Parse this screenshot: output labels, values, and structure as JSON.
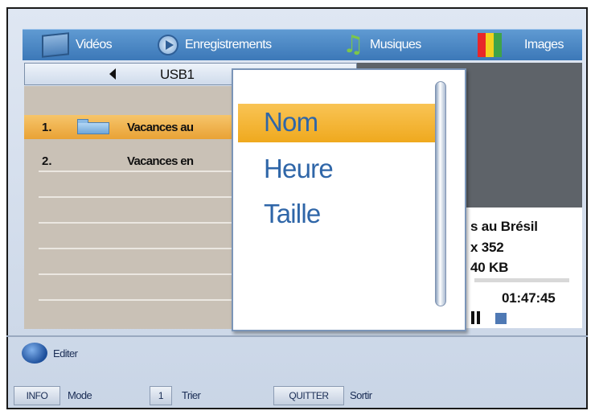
{
  "tabs": [
    {
      "label": "Vidéos",
      "icon": "video-icon"
    },
    {
      "label": "Enregistrements",
      "icon": "recordings-icon"
    },
    {
      "label": "Musiques",
      "icon": "music-icon"
    },
    {
      "label": "Images",
      "icon": "images-icon"
    }
  ],
  "breadcrumb": {
    "label": "USB1"
  },
  "files": [
    {
      "num": "1.",
      "name": "Vacances au",
      "is_folder": true,
      "selected": true
    },
    {
      "num": "2.",
      "name": "Vacances en",
      "is_folder": false,
      "selected": false
    }
  ],
  "sort_menu": {
    "options": [
      "Nom",
      "Heure",
      "Taille"
    ],
    "selected": "Nom"
  },
  "details": {
    "title": "s au Brésil",
    "resolution": "x 352",
    "size": "40 KB",
    "duration": "01:47:45"
  },
  "footer": {
    "blue_label": "Editer",
    "keys": [
      {
        "key": "INFO",
        "label": "Mode"
      },
      {
        "key": "1",
        "label": "Trier"
      },
      {
        "key": "QUITTER",
        "label": "Sortir"
      }
    ]
  },
  "colors": {
    "tabbar": "#3c78b8",
    "selection": "#f0a526",
    "popup_text": "#2f66a8",
    "preview_dark": "#5e6369"
  }
}
